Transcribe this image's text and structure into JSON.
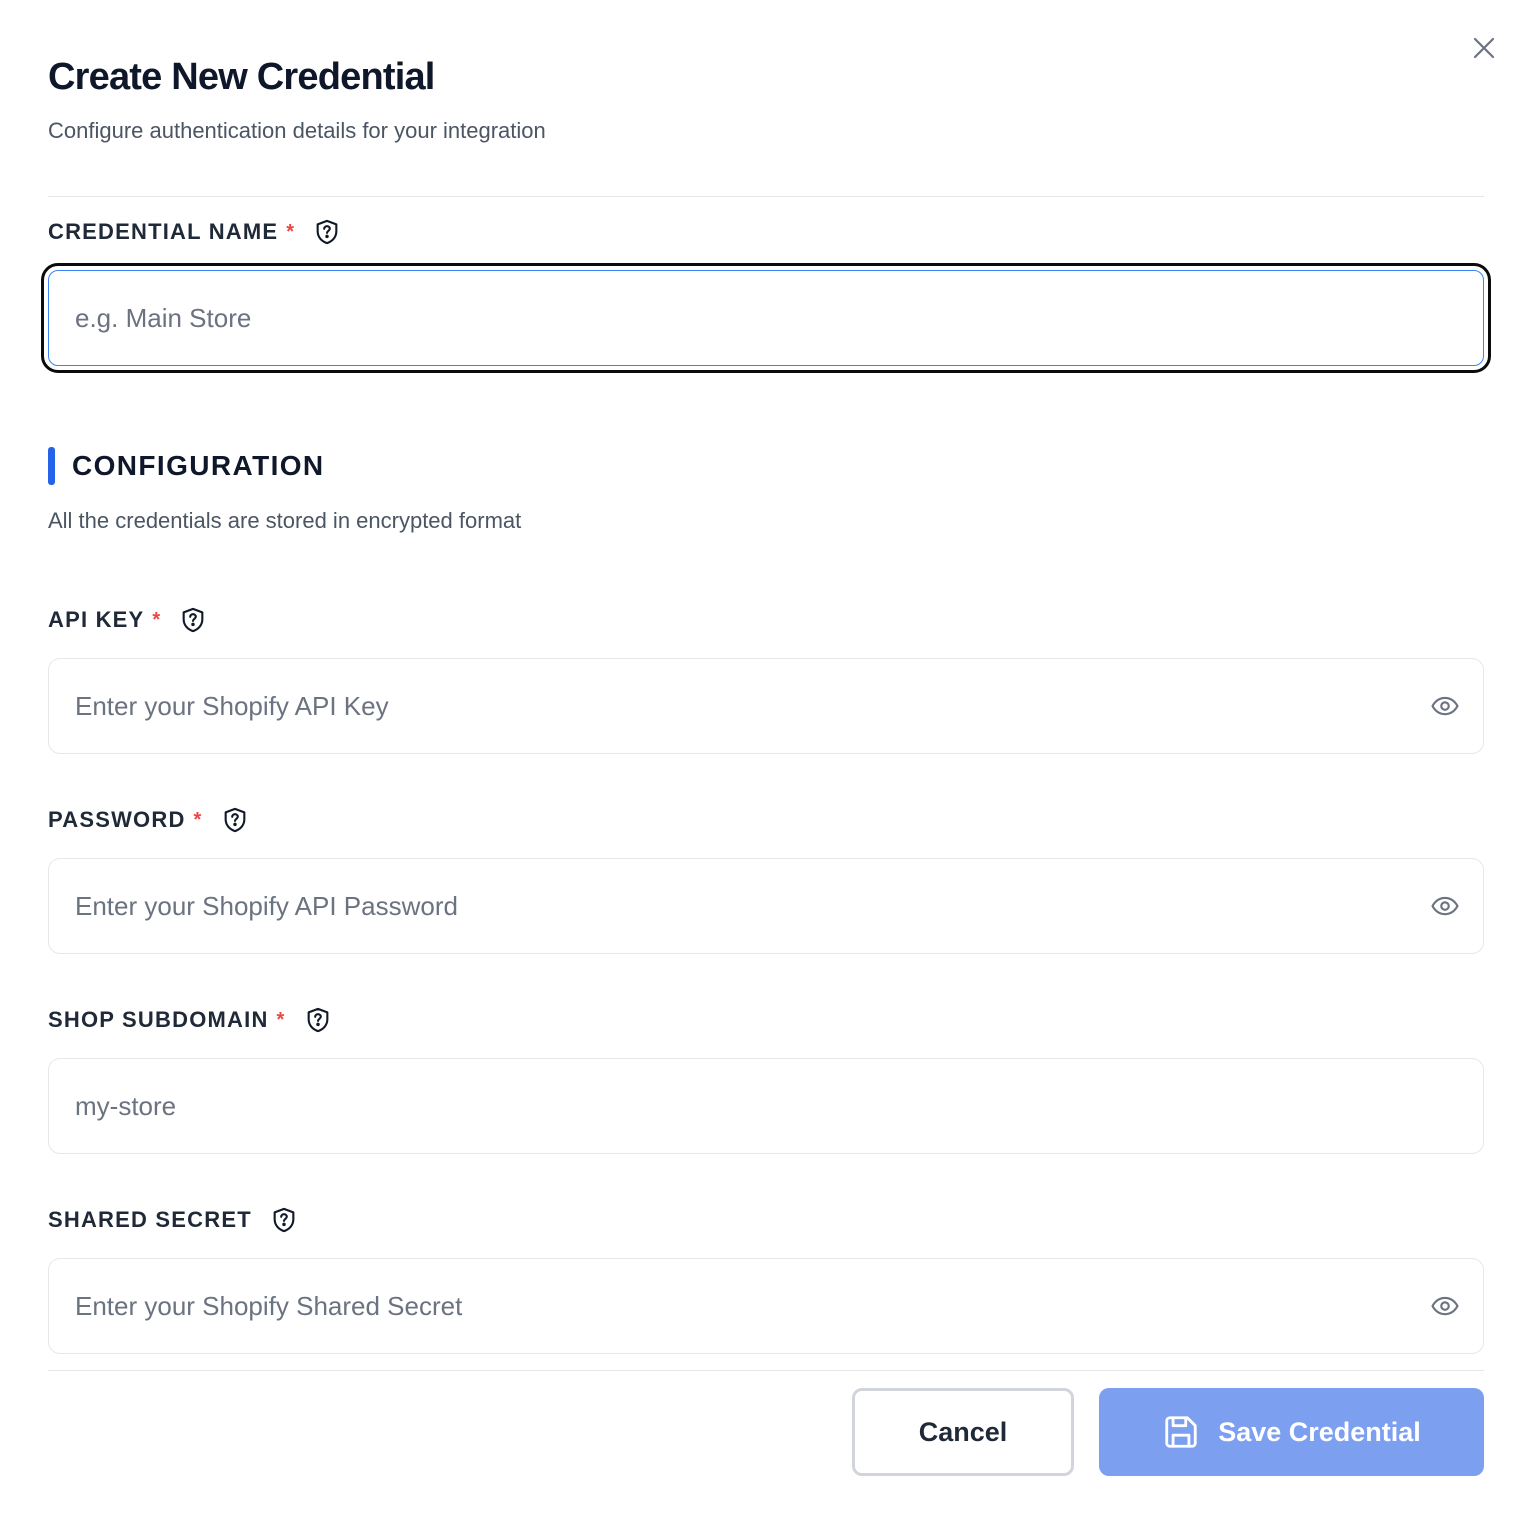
{
  "modal": {
    "title": "Create New Credential",
    "subtitle": "Configure authentication details for your integration",
    "close_icon": "close-icon"
  },
  "credential_name": {
    "label": "CREDENTIAL NAME",
    "required_mark": "*",
    "placeholder": "e.g. Main Store",
    "value": ""
  },
  "configuration": {
    "title": "CONFIGURATION",
    "description": "All the credentials are stored in encrypted format",
    "accent_color": "#2563eb"
  },
  "fields": {
    "api_key": {
      "label": "API KEY",
      "required_mark": "*",
      "placeholder": "Enter your Shopify API Key",
      "value": ""
    },
    "password": {
      "label": "PASSWORD",
      "required_mark": "*",
      "placeholder": "Enter your Shopify API Password",
      "value": ""
    },
    "shop_subdomain": {
      "label": "SHOP SUBDOMAIN",
      "required_mark": "*",
      "placeholder": "my-store",
      "value": ""
    },
    "shared_secret": {
      "label": "SHARED SECRET",
      "placeholder": "Enter your Shopify Shared Secret",
      "value": ""
    }
  },
  "footer": {
    "cancel_label": "Cancel",
    "save_label": "Save Credential",
    "save_color": "#7c9ff0"
  },
  "colors": {
    "required": "#ef4444",
    "focus_border": "#3b82f6"
  }
}
